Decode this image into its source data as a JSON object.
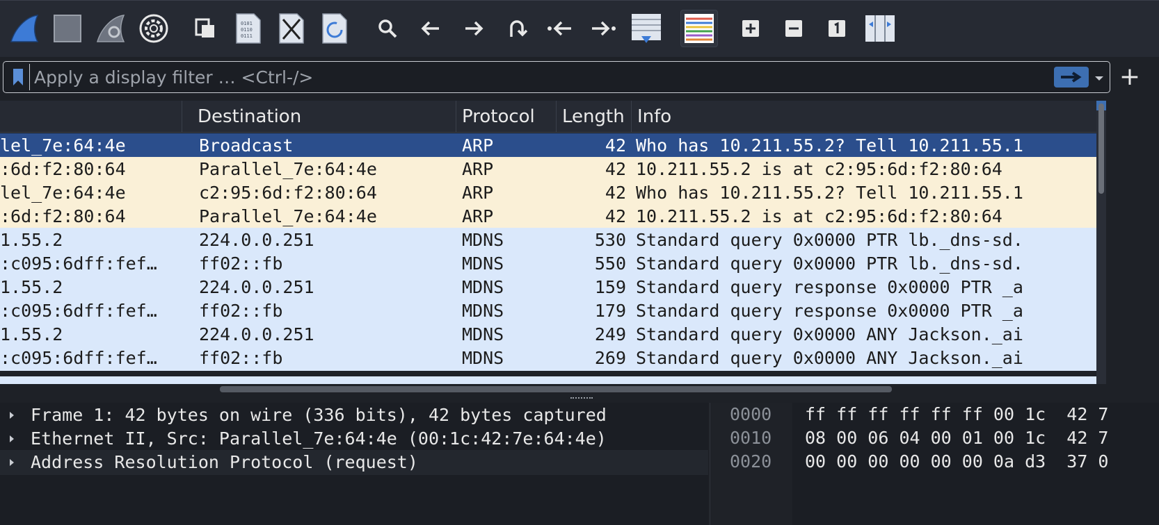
{
  "toolbar": {
    "buttons": [
      {
        "name": "start-capture",
        "icon": "shark-fin-icon"
      },
      {
        "name": "stop-capture",
        "icon": "stop-icon"
      },
      {
        "name": "restart-capture",
        "icon": "restart-fin-icon"
      },
      {
        "name": "capture-options",
        "icon": "gear-icon"
      },
      {
        "name": "open-file",
        "icon": "open-file-icon"
      },
      {
        "name": "save-file",
        "icon": "save-file-icon"
      },
      {
        "name": "close-file",
        "icon": "close-file-icon"
      },
      {
        "name": "reload-file",
        "icon": "reload-file-icon"
      },
      {
        "name": "find-packet",
        "icon": "search-icon"
      },
      {
        "name": "go-back",
        "icon": "arrow-left-icon"
      },
      {
        "name": "go-forward",
        "icon": "arrow-right-icon"
      },
      {
        "name": "go-to-packet",
        "icon": "jump-icon"
      },
      {
        "name": "go-first",
        "icon": "first-packet-icon"
      },
      {
        "name": "go-last",
        "icon": "last-packet-icon"
      },
      {
        "name": "autoscroll",
        "icon": "autoscroll-icon"
      },
      {
        "name": "colorize",
        "icon": "colorize-icon"
      },
      {
        "name": "zoom-in",
        "icon": "zoom-in-icon"
      },
      {
        "name": "zoom-out",
        "icon": "zoom-out-icon"
      },
      {
        "name": "normal-size",
        "icon": "normal-size-icon"
      },
      {
        "name": "resize-columns",
        "icon": "resize-columns-icon"
      }
    ]
  },
  "filter": {
    "placeholder": "Apply a display filter … <Ctrl-/>",
    "value": "",
    "plus": "+"
  },
  "columns": {
    "destination": "Destination",
    "protocol": "Protocol",
    "length": "Length",
    "info": "Info"
  },
  "packets": [
    {
      "source": "lel_7e:64:4e",
      "destination": "Broadcast",
      "protocol": "ARP",
      "length": "42",
      "info": "Who has 10.211.55.2? Tell 10.211.55.1",
      "kind": "sel"
    },
    {
      "source": ":6d:f2:80:64",
      "destination": "Parallel_7e:64:4e",
      "protocol": "ARP",
      "length": "42",
      "info": "10.211.55.2 is at c2:95:6d:f2:80:64",
      "kind": "arp"
    },
    {
      "source": "lel_7e:64:4e",
      "destination": "c2:95:6d:f2:80:64",
      "protocol": "ARP",
      "length": "42",
      "info": "Who has 10.211.55.2? Tell 10.211.55.1",
      "kind": "arp"
    },
    {
      "source": ":6d:f2:80:64",
      "destination": "Parallel_7e:64:4e",
      "protocol": "ARP",
      "length": "42",
      "info": "10.211.55.2 is at c2:95:6d:f2:80:64",
      "kind": "arp"
    },
    {
      "source": "1.55.2",
      "destination": "224.0.0.251",
      "protocol": "MDNS",
      "length": "530",
      "info": "Standard query 0x0000 PTR lb._dns-sd.",
      "kind": "mdns"
    },
    {
      "source": ":c095:6dff:fef…",
      "destination": "ff02::fb",
      "protocol": "MDNS",
      "length": "550",
      "info": "Standard query 0x0000 PTR lb._dns-sd.",
      "kind": "mdns"
    },
    {
      "source": "1.55.2",
      "destination": "224.0.0.251",
      "protocol": "MDNS",
      "length": "159",
      "info": "Standard query response 0x0000 PTR _a",
      "kind": "mdns"
    },
    {
      "source": ":c095:6dff:fef…",
      "destination": "ff02::fb",
      "protocol": "MDNS",
      "length": "179",
      "info": "Standard query response 0x0000 PTR _a",
      "kind": "mdns"
    },
    {
      "source": "1.55.2",
      "destination": "224.0.0.251",
      "protocol": "MDNS",
      "length": "249",
      "info": "Standard query 0x0000 ANY Jackson._ai",
      "kind": "mdns"
    },
    {
      "source": ":c095:6dff:fef…",
      "destination": "ff02::fb",
      "protocol": "MDNS",
      "length": "269",
      "info": "Standard query 0x0000 ANY Jackson._ai",
      "kind": "mdns"
    }
  ],
  "details": [
    "Frame 1: 42 bytes on wire (336 bits), 42 bytes captured",
    "Ethernet II, Src: Parallel_7e:64:4e (00:1c:42:7e:64:4e)",
    "Address Resolution Protocol (request)"
  ],
  "bytes": [
    {
      "offset": "0000",
      "hex": "ff ff ff ff ff ff 00 1c  42 7"
    },
    {
      "offset": "0010",
      "hex": "08 00 06 04 00 01 00 1c  42 7"
    },
    {
      "offset": "0020",
      "hex": "00 00 00 00 00 00 0a d3  37 0"
    }
  ],
  "colors": {
    "selected_row": "#2b4e8c",
    "arp_row": "#faf0d7",
    "mdns_row": "#dae8fb",
    "accent": "#3d6fb2"
  }
}
